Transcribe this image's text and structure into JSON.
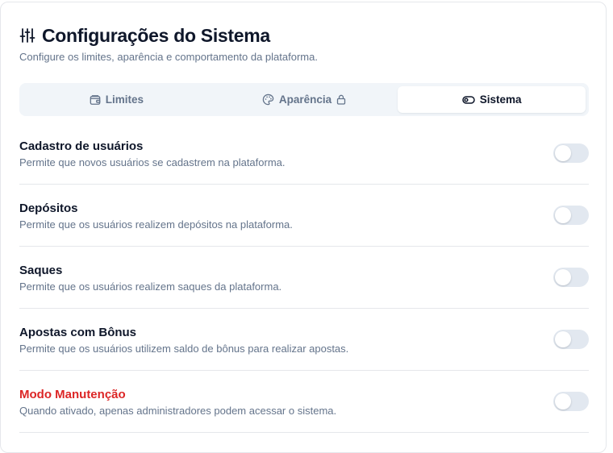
{
  "header": {
    "title": "Configurações do Sistema",
    "subtitle": "Configure os limites, aparência e comportamento da plataforma.",
    "icon": "sliders-icon"
  },
  "tabs": [
    {
      "label": "Limites",
      "icon": "wallet-icon",
      "active": false,
      "locked": false
    },
    {
      "label": "Aparência",
      "icon": "palette-icon",
      "active": false,
      "locked": true
    },
    {
      "label": "Sistema",
      "icon": "toggle-icon",
      "active": true,
      "locked": false
    }
  ],
  "settings": [
    {
      "label": "Cadastro de usuários",
      "description": "Permite que novos usuários se cadastrem na plataforma.",
      "enabled": false,
      "danger": false
    },
    {
      "label": "Depósitos",
      "description": "Permite que os usuários realizem depósitos na plataforma.",
      "enabled": false,
      "danger": false
    },
    {
      "label": "Saques",
      "description": "Permite que os usuários realizem saques da plataforma.",
      "enabled": false,
      "danger": false
    },
    {
      "label": "Apostas com Bônus",
      "description": "Permite que os usuários utilizem saldo de bônus para realizar apostas.",
      "enabled": false,
      "danger": false
    },
    {
      "label": "Modo Manutenção",
      "description": "Quando ativado, apenas administradores podem acessar o sistema.",
      "enabled": false,
      "danger": true
    }
  ],
  "colors": {
    "text": "#0f172a",
    "muted": "#64748b",
    "danger": "#dc2626",
    "tab_bg": "#f1f5f9",
    "toggle_off": "#e2e8f0",
    "border": "#e5e7eb"
  }
}
